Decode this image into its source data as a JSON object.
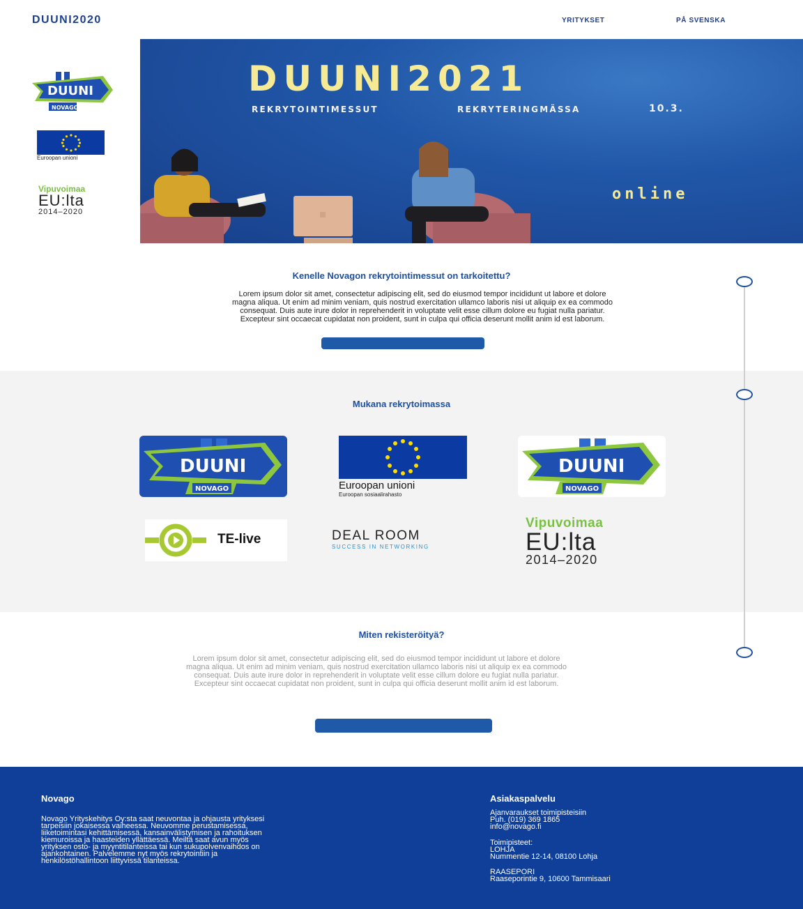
{
  "header": {
    "brand": "DUUNI2020",
    "nav": [
      "YRITYKSET",
      "PÅ SVENSKA"
    ]
  },
  "hero": {
    "title": "DUUNI2021",
    "subtitle_fi": "REKRYTOINTIMESSUT",
    "subtitle_sv": "REKRYTERINGMÄSSA",
    "date": "10.3.",
    "online": "online"
  },
  "logos": {
    "duuni_text": "DUUNI",
    "duuni_year": "2021",
    "novago": "NOVAGO",
    "eu_name": "Euroopan unioni",
    "eu_fund": "Euroopan sosiaalirahasto",
    "vipu_green": "Vipuvoimaa",
    "vipu_big": "EU:lta",
    "vipu_years": "2014–2020",
    "te_live": "TE-live",
    "dealroom": "DEAL ROOM",
    "dealroom_tag": "SUCCESS IN NETWORKING"
  },
  "section1": {
    "title": "Kenelle Novagon rekrytointimessut on tarkoitettu?",
    "body": [
      "Lorem ipsum dolor sit amet, consectetur adipiscing elit, sed do eiusmod tempor incididunt ut labore et dolore",
      "magna aliqua. Ut enim ad minim veniam, quis nostrud exercitation ullamco laboris nisi ut aliquip ex ea commodo",
      "consequat. Duis aute irure dolor in reprehenderit in voluptate velit esse cillum dolore eu fugiat nulla pariatur.",
      "Excepteur sint occaecat cupidatat non proident, sunt in culpa qui officia deserunt mollit anim id est laborum."
    ]
  },
  "section2": {
    "title": "Mukana rekrytoimassa"
  },
  "section3": {
    "title": "Miten rekisteröityä?",
    "body": [
      "Lorem ipsum dolor sit amet, consectetur adipiscing elit, sed do eiusmod tempor incididunt ut labore et dolore",
      "magna aliqua. Ut enim ad minim veniam, quis nostrud exercitation ullamco laboris nisi ut aliquip ex ea commodo",
      "consequat. Duis aute irure dolor in reprehenderit in voluptate velit esse cillum dolore eu fugiat nulla pariatur.",
      "Excepteur sint occaecat cupidatat non proident, sunt in culpa qui officia deserunt mollit anim id est laborum."
    ]
  },
  "footer": {
    "left_title": "Novago",
    "left_body": [
      "Novago Yrityskehitys Oy:sta saat neuvontaa ja ohjausta yrityksesi",
      "tarpeisiin jokaisessa vaiheessa. Neuvomme perustamisessa,",
      "liiketoimintasi kehittämisessä, kansainvälistymisen ja rahoituksen",
      "kiemuroissa ja haasteiden yllättäessä. Meiltä saat avun myös",
      "yrityksen osto- ja myyntitilanteissa tai kun sukupolvenvaihdos on",
      "ajankohtainen. Palvelemme nyt myös rekrytointiin ja",
      "henkilöstöhallintoon liittyvissä tilanteissa."
    ],
    "right_title": "Asiakaspalvelu",
    "right_lines": [
      "Ajanvaraukset toimipisteisiin",
      "Puh. (019) 369 1865",
      "info@novago.fi"
    ],
    "offices_label": "Toimipisteet:",
    "lohja_name": "LOHJA",
    "lohja_addr": "Nummentie 12-14, 08100 Lohja",
    "raasepori_name": "RAASEPORI",
    "raasepori_addr": "Raaseporintie 9, 10600 Tammisaari"
  },
  "colors": {
    "brand_blue": "#1d3f8c",
    "hero_blue": "#2157a8",
    "hero_yellow": "#f6eb94",
    "cta_blue": "#1f5aa8",
    "footer_blue": "#0f3f99",
    "duuni_green": "#8dc63f"
  }
}
